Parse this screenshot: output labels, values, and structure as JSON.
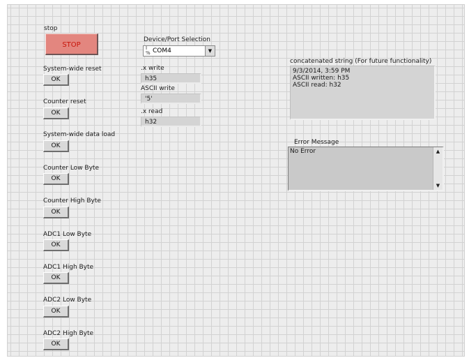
{
  "stop": {
    "label": "stop",
    "button": "STOP"
  },
  "device": {
    "label": "Device/Port Selection",
    "value": "COM4",
    "io_glyph": "I/O",
    "arrow": "▼"
  },
  "x_write": {
    "label": ".x write",
    "value": "h35"
  },
  "ascii_write": {
    "label": "ASCII write",
    "value": "'5'"
  },
  "x_read": {
    "label": ".x read",
    "value": "h32"
  },
  "concat": {
    "label": "concatenated string (For future functionality)",
    "lines": [
      "9/3/2014, 3:59 PM",
      "ASCII written: h35",
      "ASCII read: h32"
    ]
  },
  "error": {
    "label": "Error Message",
    "value": "No Error",
    "scroll_up": "▲",
    "scroll_down": "▼"
  },
  "controls": [
    {
      "label": "System-wide reset",
      "button": "OK"
    },
    {
      "label": "Counter reset",
      "button": "OK"
    },
    {
      "label": "System-wide data load",
      "button": "OK"
    },
    {
      "label": "Counter Low Byte",
      "button": "OK"
    },
    {
      "label": "Counter High Byte",
      "button": "OK"
    },
    {
      "label": "ADC1 Low Byte",
      "button": "OK"
    },
    {
      "label": "ADC1 High Byte",
      "button": "OK"
    },
    {
      "label": "ADC2 Low Byte",
      "button": "OK"
    },
    {
      "label": "ADC2 High Byte",
      "button": "OK"
    }
  ]
}
